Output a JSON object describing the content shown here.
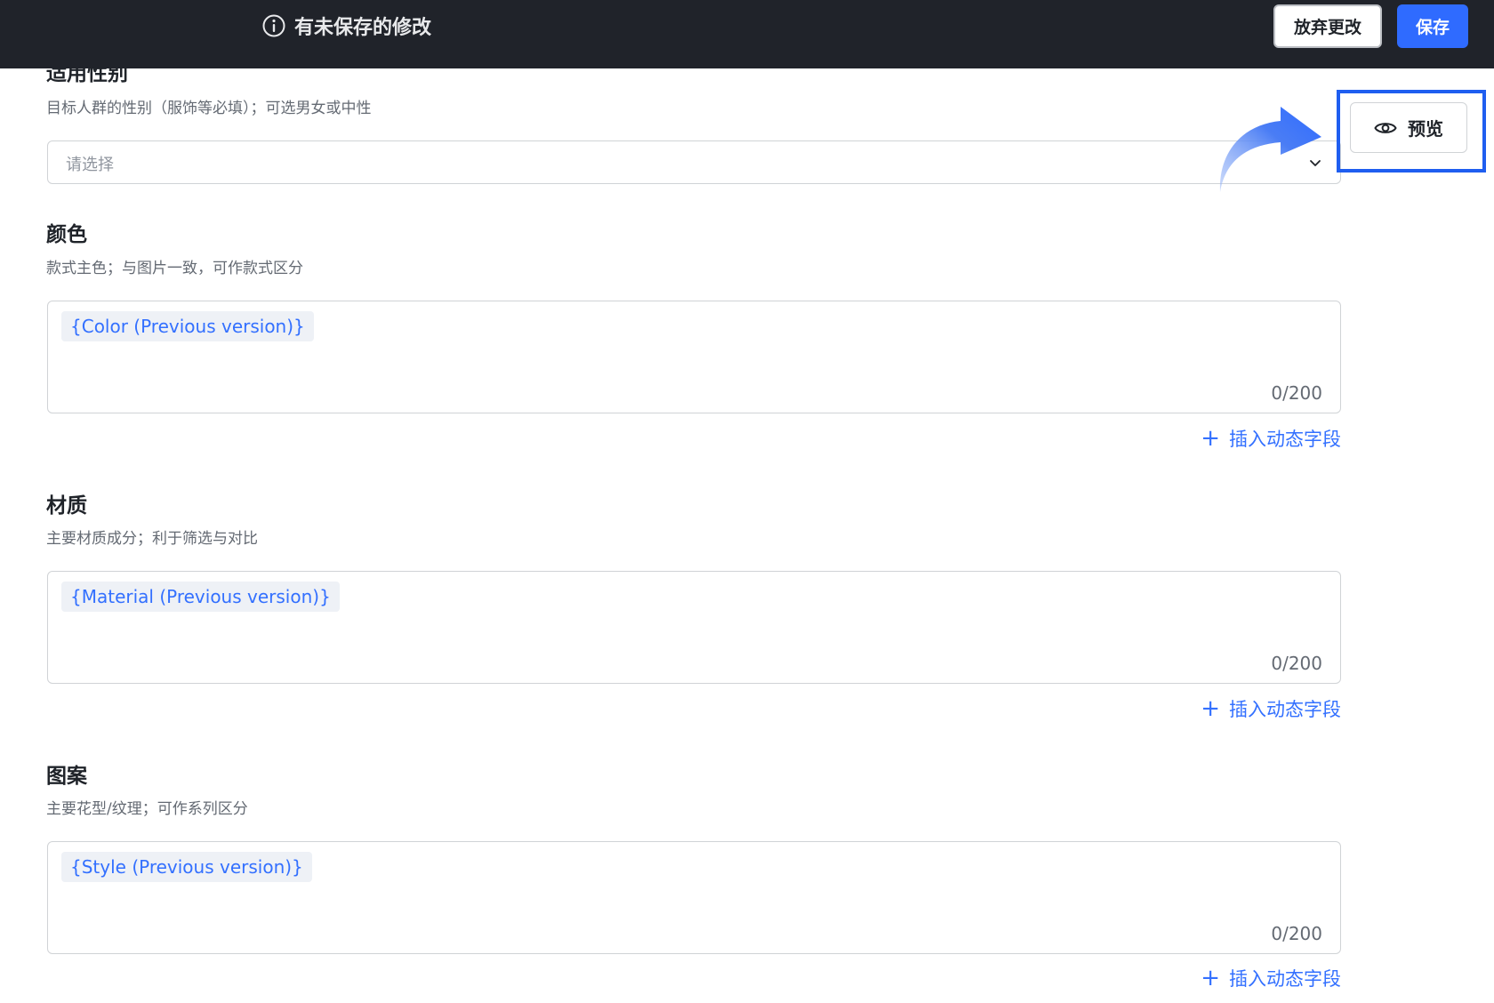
{
  "topbar": {
    "status_text": "有未保存的修改",
    "discard_label": "放弃更改",
    "save_label": "保存",
    "accent": "#2f6bff"
  },
  "gender_field": {
    "title": "适用性别",
    "description": "目标人群的性别（服饰等必填）；可选男女或中性",
    "placeholder": "请选择"
  },
  "preview": {
    "label": "预览",
    "icon": "eye-icon"
  },
  "fields": [
    {
      "title": "颜色",
      "description": "款式主色；与图片一致，可作款式区分",
      "chip": "{Color (Previous version)}",
      "counter": "0/200",
      "insert_label": "插入动态字段"
    },
    {
      "title": "材质",
      "description": "主要材质成分；利于筛选与对比",
      "chip": "{Material (Previous version)}",
      "counter": "0/200",
      "insert_label": "插入动态字段"
    },
    {
      "title": "图案",
      "description": "主要花型/纹理；可作系列区分",
      "chip": "{Style (Previous version)}",
      "counter": "0/200",
      "insert_label": "插入动态字段"
    }
  ]
}
